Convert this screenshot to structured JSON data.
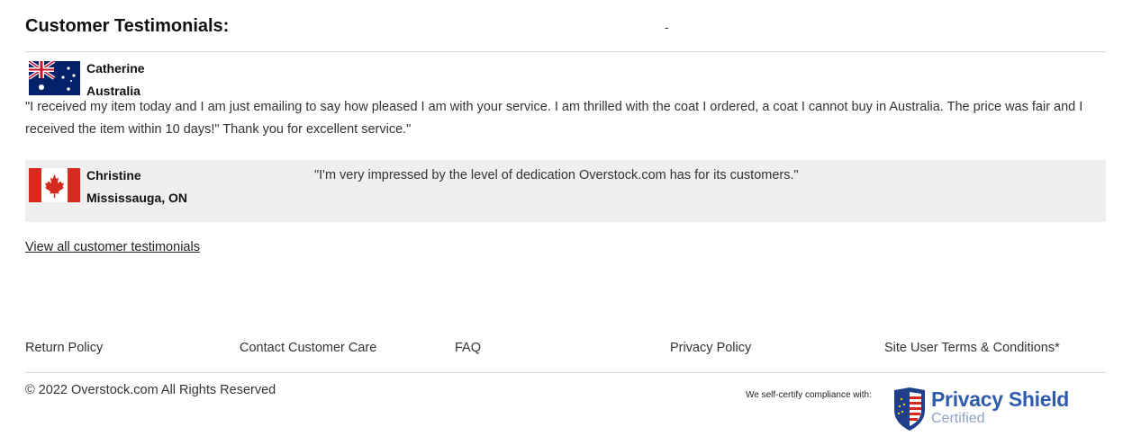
{
  "section_title": "Customer Testimonials:",
  "header_dash": "-",
  "testimonials": [
    {
      "name": "Catherine",
      "location": "Australia",
      "flag": "australia-flag",
      "quote": "\"I received my item today and I am just emailing to say how pleased I am with your service. I am thrilled with the coat I ordered, a coat I cannot buy in Australia. The price was fair and I received the item within 10 days!\" Thank you for excellent service.\""
    },
    {
      "name": "Christine",
      "location": "Mississauga, ON",
      "flag": "canada-flag",
      "quote": "\"I'm very impressed by the level of dedication Overstock.com has for its customers.\""
    }
  ],
  "view_all_link": "View all customer testimonials",
  "footer": {
    "links": [
      "Return Policy",
      "Contact Customer Care",
      "FAQ",
      "Privacy Policy",
      "Site User Terms & Conditions*"
    ],
    "copyright": "© 2022 Overstock.com All Rights Reserved",
    "self_certify": "We self-certify compliance with:",
    "privacy_shield_title": "Privacy Shield",
    "privacy_shield_sub": "Certified"
  },
  "colors": {
    "highlight_row": "#efefef",
    "privacy_shield_blue": "#2f5caa",
    "canada_red": "#d52b1e",
    "australia_blue": "#012169"
  }
}
